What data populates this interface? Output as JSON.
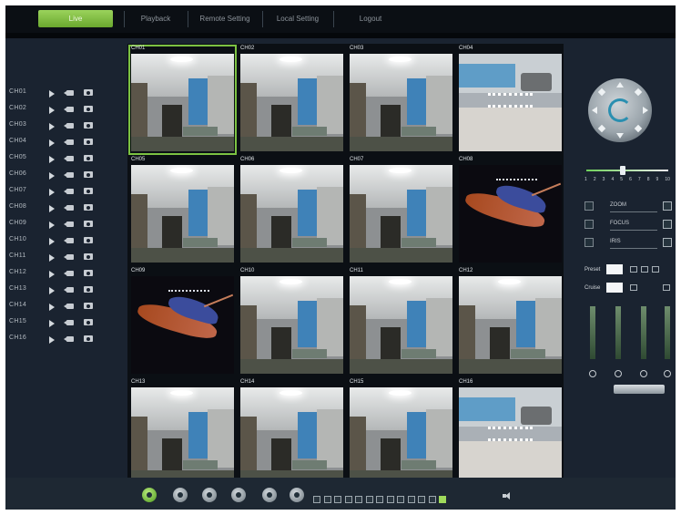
{
  "menu": {
    "items": [
      {
        "label": "Live",
        "active": true
      },
      {
        "label": "Playback",
        "active": false
      },
      {
        "label": "Remote Setting",
        "active": false
      },
      {
        "label": "Local Setting",
        "active": false
      },
      {
        "label": "Logout",
        "active": false
      }
    ]
  },
  "channels": [
    "CH01",
    "CH02",
    "CH03",
    "CH04",
    "CH05",
    "CH06",
    "CH07",
    "CH08",
    "CH09",
    "CH10",
    "CH11",
    "CH12",
    "CH13",
    "CH14",
    "CH15",
    "CH16"
  ],
  "grid": {
    "selected_index": 0,
    "cells": [
      {
        "label": "CH01",
        "scene": "office"
      },
      {
        "label": "CH02",
        "scene": "office"
      },
      {
        "label": "CH03",
        "scene": "office"
      },
      {
        "label": "CH04",
        "scene": "street"
      },
      {
        "label": "CH05",
        "scene": "office"
      },
      {
        "label": "CH06",
        "scene": "office"
      },
      {
        "label": "CH07",
        "scene": "office"
      },
      {
        "label": "CH08",
        "scene": "fish"
      },
      {
        "label": "CH09",
        "scene": "fish"
      },
      {
        "label": "CH10",
        "scene": "office"
      },
      {
        "label": "CH11",
        "scene": "office"
      },
      {
        "label": "CH12",
        "scene": "office"
      },
      {
        "label": "CH13",
        "scene": "office"
      },
      {
        "label": "CH14",
        "scene": "office"
      },
      {
        "label": "CH15",
        "scene": "office"
      },
      {
        "label": "CH16",
        "scene": "street"
      }
    ]
  },
  "ptz": {
    "speed_ticks": [
      "1",
      "2",
      "3",
      "4",
      "5",
      "6",
      "7",
      "8",
      "9",
      "10"
    ],
    "speed_value": 5,
    "controls": [
      "ZOOM",
      "FOCUS",
      "IRIS"
    ],
    "preset_label": "Preset",
    "cruise_label": "Cruise"
  },
  "colors": {
    "accent": "#7cc242",
    "background": "#1a2330",
    "topbar": "#0b0f14"
  },
  "icons": {
    "play": "play-icon",
    "record": "record-icon",
    "snapshot": "snapshot-icon",
    "volume": "volume-icon"
  }
}
